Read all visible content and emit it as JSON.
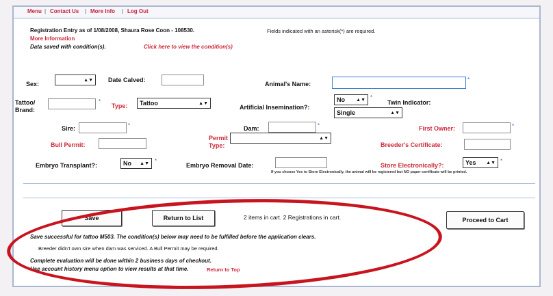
{
  "nav": {
    "items": [
      "Menu",
      "Contact Us",
      "More Info",
      "Log Out"
    ],
    "separator": "|"
  },
  "header": {
    "entry_info": "Registration Entry as of 1/08/2008, Shaura Rose Coon - 108530.",
    "required_note": "Fields indicated with an asterisk(*) are required.",
    "more_information": "More Information",
    "saved_condition": "Data saved with condition(s).",
    "view_conditions_link": "Click here to view the condition(s)"
  },
  "form": {
    "sex_label": "Sex:",
    "sex_value": "",
    "date_calved_label": "Date Calved:",
    "date_calved_value": "",
    "animal_name_label": "Animal's Name:",
    "animal_name_value": "",
    "tattoo_brand_label_1": "Tattoo/",
    "tattoo_brand_label_2": "Brand:",
    "type_label": "Type:",
    "type_value": "Tattoo",
    "ai_label": "Artificial Insemination?:",
    "ai_value": "No",
    "twin_label": "Twin Indicator:",
    "twin_value": "Single",
    "sire_label": "Sire:",
    "dam_label": "Dam:",
    "first_owner_label": "First Owner:",
    "bull_permit_label": "Bull Permit:",
    "permit_type_label_1": "Permit",
    "permit_type_label_2": "Type:",
    "breeders_cert_label": "Breeder's Certificate:",
    "embryo_transplant_label": "Embryo Transplant?:",
    "embryo_transplant_value": "No",
    "embryo_removal_label": "Embryo Removal Date:",
    "store_electronically_label": "Store Electronically?:",
    "store_electronically_value": "Yes",
    "store_note": "If you choose Yes to Store Electronically, the animal will be registered but NO paper certificate will be printed."
  },
  "actions": {
    "save_label": "Save",
    "return_label": "Return to List",
    "cart_status": "2 items in cart. 2 Registrations in cart.",
    "proceed_label": "Proceed to Cart"
  },
  "messages": {
    "success": "Save successful for tattoo M503. The condition(s) below may need to be fulfilled before the application clears.",
    "condition": "Breeder didn't own sire when dam was serviced. A Bull Permit may be required.",
    "evaluation": "Complete evaluation will be done within 2 business days of checkout.",
    "history": "Use account history menu option to view results at that time.",
    "return_top": "Return to Top"
  },
  "colors": {
    "link_red": "#cc2a3c",
    "annotation_red": "#c8141e",
    "rule_blue": "#a9bfdc"
  }
}
